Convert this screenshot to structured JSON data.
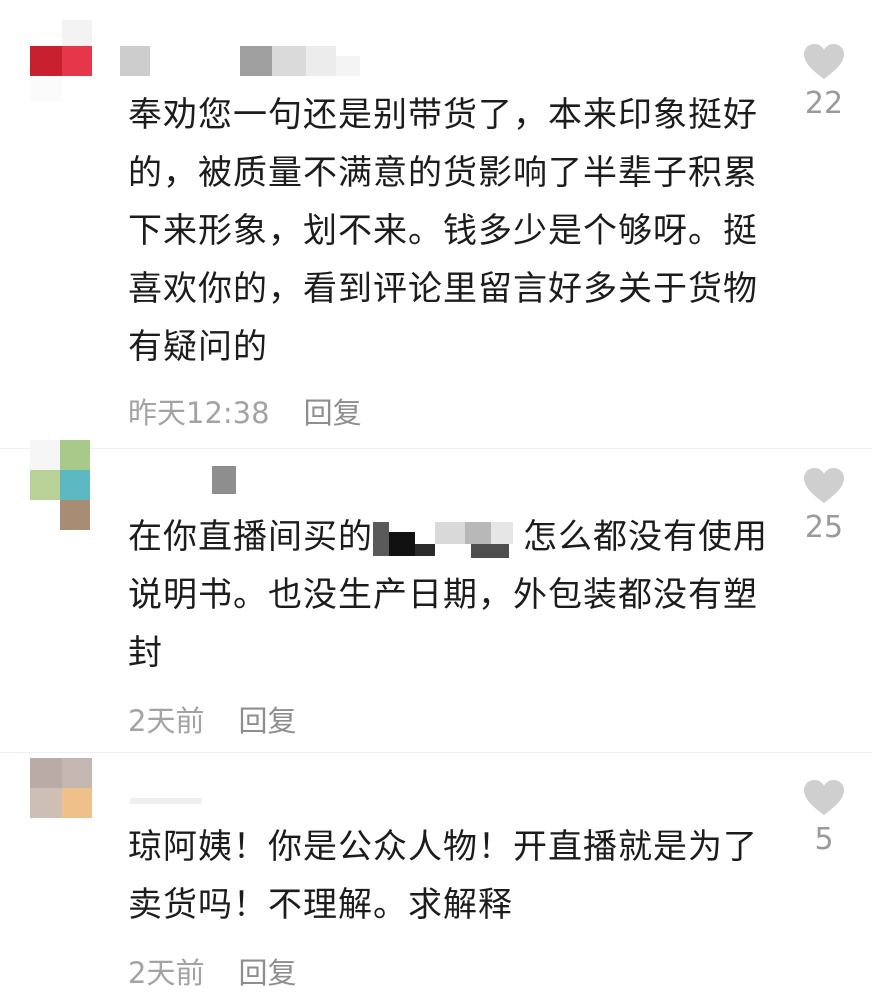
{
  "comments": [
    {
      "text": "奉劝您一句还是别带货了，本来印象挺好的，被质量不满意的货影响了半辈子积累下来形象，划不来。钱多少是个够呀。挺喜欢你的，看到评论里留言好多关于货物有疑问的",
      "time": "昨天12:38",
      "reply": "回复",
      "likes": "22"
    },
    {
      "text_before": "在你直播间买的",
      "text_after": "怎么都没有使用说明书。也没生产日期，外包装都没有塑封",
      "time": "2天前",
      "reply": "回复",
      "likes": "25"
    },
    {
      "text": "琼阿姨！你是公众人物！开直播就是为了卖货吗！不理解。求解释",
      "time": "2天前",
      "reply": "回复",
      "likes": "5"
    }
  ],
  "icons": {
    "like": "heart-icon"
  },
  "colors": {
    "heart": "#cfcfcf",
    "meta": "#a3a3a3",
    "text": "#1c1c1c"
  }
}
